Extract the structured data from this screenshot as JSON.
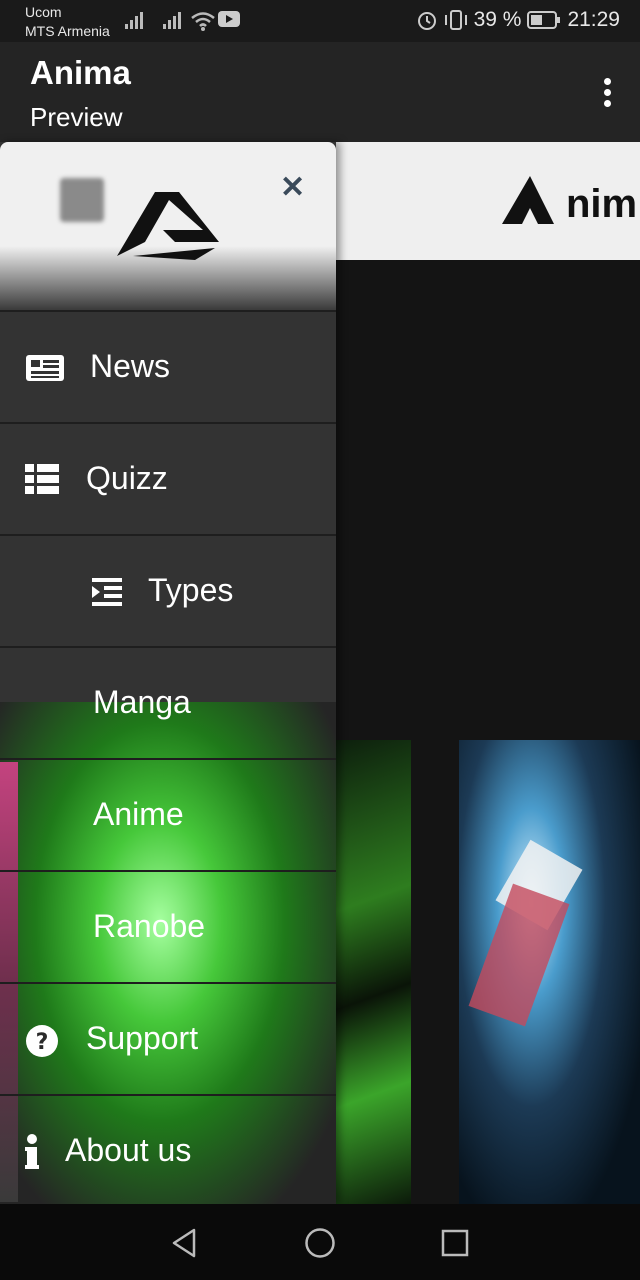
{
  "status": {
    "carrier_line1": "Ucom",
    "carrier_line2": "MTS Armenia",
    "battery": "39 %",
    "time": "21:29"
  },
  "appbar": {
    "title": "Anima",
    "subtitle": "Preview"
  },
  "content": {
    "brand_text": "nim"
  },
  "drawer": {
    "items": [
      {
        "label": "News",
        "icon": "newspaper-icon"
      },
      {
        "label": "Quizz",
        "icon": "list-icon"
      },
      {
        "label": "Types",
        "icon": "indent-icon"
      },
      {
        "label": "Manga",
        "icon": ""
      },
      {
        "label": "Anime",
        "icon": ""
      },
      {
        "label": "Ranobe",
        "icon": ""
      },
      {
        "label": "Support",
        "icon": "question-circle-icon"
      },
      {
        "label": "About us",
        "icon": "info-icon"
      }
    ]
  },
  "navbar": {
    "buttons": [
      "back-icon",
      "home-icon",
      "recents-icon"
    ]
  }
}
